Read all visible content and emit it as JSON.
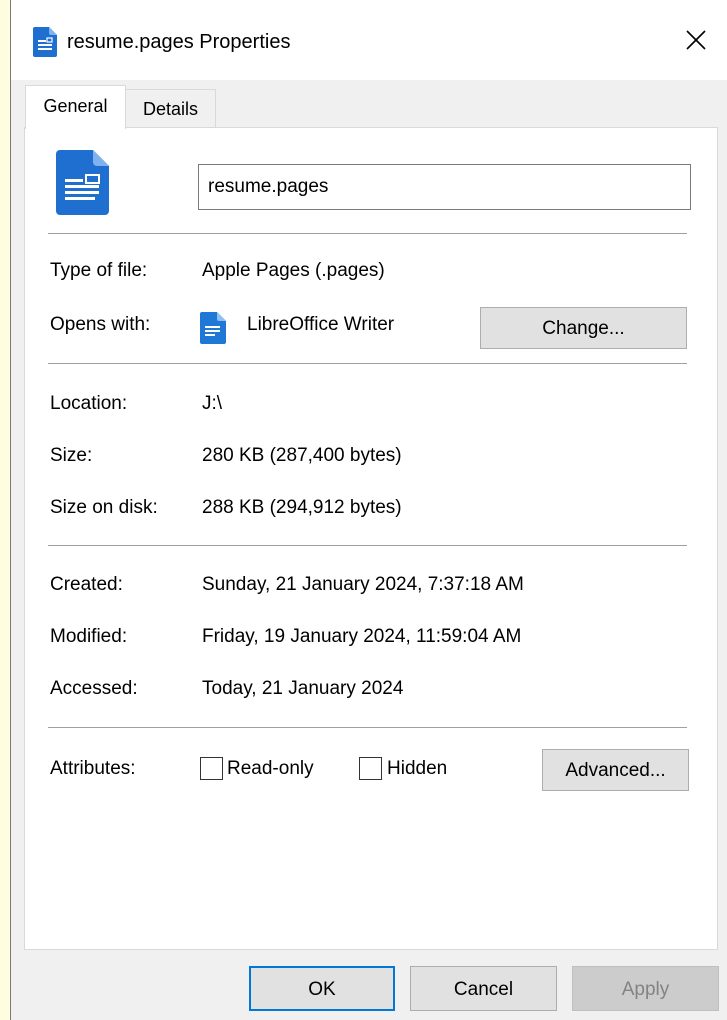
{
  "window": {
    "title": "resume.pages Properties"
  },
  "tabs": [
    {
      "label": "General",
      "active": true
    },
    {
      "label": "Details",
      "active": false
    }
  ],
  "general": {
    "file_name": "resume.pages",
    "type_label": "Type of file:",
    "type_value": "Apple Pages (.pages)",
    "opens_label": "Opens with:",
    "opens_value": "LibreOffice Writer",
    "change_button": "Change...",
    "location_label": "Location:",
    "location_value": "J:\\",
    "size_label": "Size:",
    "size_value": "280 KB (287,400 bytes)",
    "size_on_disk_label": "Size on disk:",
    "size_on_disk_value": "288 KB (294,912 bytes)",
    "created_label": "Created:",
    "created_value": "Sunday, 21 January 2024, 7:37:18 AM",
    "modified_label": "Modified:",
    "modified_value": "Friday, 19 January 2024, 11:59:04 AM",
    "accessed_label": "Accessed:",
    "accessed_value": "Today, 21 January 2024",
    "attributes_label": "Attributes:",
    "readonly_label": "Read-only",
    "readonly_checked": false,
    "hidden_label": "Hidden",
    "hidden_checked": false,
    "advanced_button": "Advanced..."
  },
  "footer": {
    "ok": "OK",
    "cancel": "Cancel",
    "apply": "Apply"
  },
  "colors": {
    "accent": "#0078d7",
    "file_icon": "#1f6fd1",
    "dialog_bg": "#f0f0f0"
  },
  "icons": {
    "title": "document-icon",
    "file": "document-icon",
    "opens_with": "libreoffice-writer-icon",
    "close": "close-icon"
  }
}
